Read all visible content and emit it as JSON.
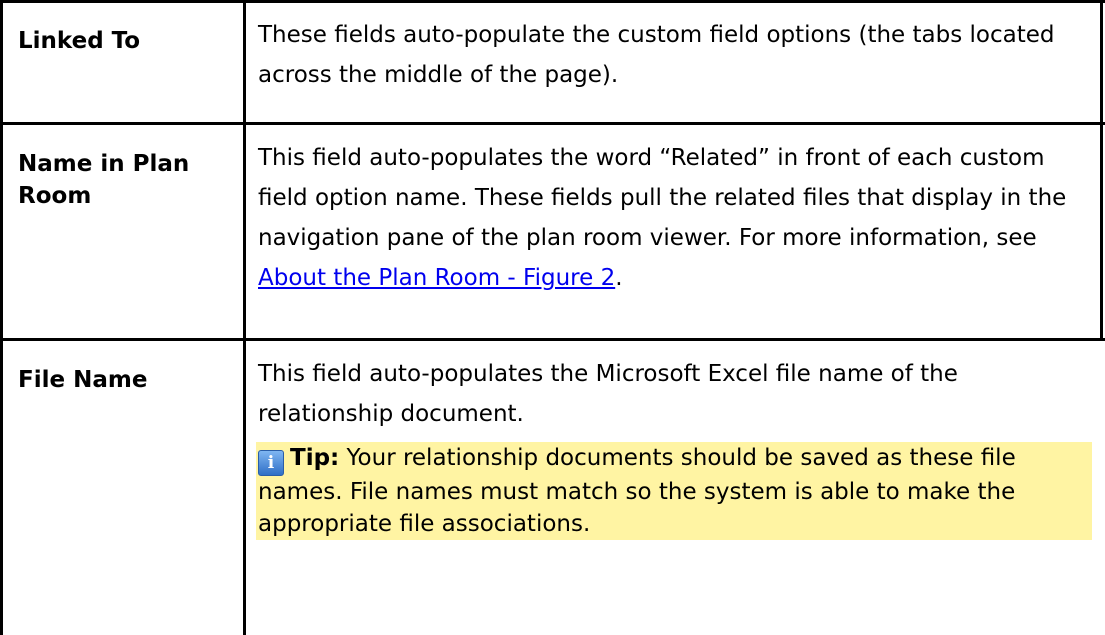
{
  "rows": [
    {
      "term": "Linked To",
      "description": "These fields auto-populate the custom field options (the tabs located across the middle of the page)."
    },
    {
      "term": "Name in Plan Room",
      "description_before_link": "This field auto-populates the word “Related” in front of each custom field option name. These fields pull the related files that display in the navigation pane of the plan room viewer. For more information, see ",
      "link_text": "About the Plan Room - Figure 2",
      "description_after_link": "."
    },
    {
      "term": "File Name",
      "description": "This field auto-populates the Microsoft Excel file name of the relationship document.",
      "tip": {
        "icon": "info-icon",
        "icon_glyph": "i",
        "label": "Tip:",
        "text": " Your relationship documents should be saved as these file names. File names must match so the system is able to make the appropriate file associations."
      }
    }
  ],
  "colors": {
    "border": "#000000",
    "link": "#0000ee",
    "tip_background": "#fff4a3"
  }
}
